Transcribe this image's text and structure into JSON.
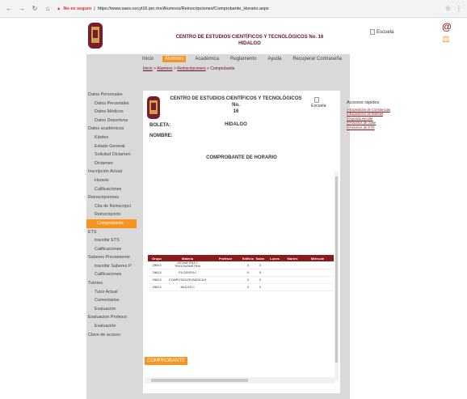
{
  "browser": {
    "insecure_label": "No es seguro",
    "url": "https://www.saes.cecyt16.ipn.mx/Alumnos/Reinscripciones/Comprobante_Horario.aspx"
  },
  "header": {
    "title_line1": "CENTRO DE ESTUDIOS CIENTÍFICOS Y TECNOLÓGICOS No. 16",
    "title_line2": "HIDALGO",
    "escuela_label": "Escuela"
  },
  "top_nav": [
    {
      "label": "Inicio",
      "active": false
    },
    {
      "label": "Alumnos",
      "active": true
    },
    {
      "label": "Académica",
      "active": false
    },
    {
      "label": "Reglamento",
      "active": false
    },
    {
      "label": "Ayuda",
      "active": false
    },
    {
      "label": "Recuperar Contraseña",
      "active": false
    }
  ],
  "breadcrumb": {
    "items": [
      "Inicio",
      "Alumnos",
      "Reinscripciones"
    ],
    "current": "Comprobante",
    "separator": " > "
  },
  "sidebar": [
    {
      "label": "Datos Personales",
      "level": 0
    },
    {
      "label": "Datos Personales",
      "level": 1
    },
    {
      "label": "Datos Médicos",
      "level": 1
    },
    {
      "label": "Datos Deportivos",
      "level": 1
    },
    {
      "label": "Datos académicos",
      "level": 0
    },
    {
      "label": "Kárdex",
      "level": 1
    },
    {
      "label": "Estado General",
      "level": 1
    },
    {
      "label": "Solicitud Dictamen",
      "level": 1
    },
    {
      "label": "Dictamen",
      "level": 1
    },
    {
      "label": "Inscripción Actual",
      "level": 0
    },
    {
      "label": "Horario",
      "level": 1
    },
    {
      "label": "Calificaciones",
      "level": 1
    },
    {
      "label": "Reinscripciones",
      "level": 0
    },
    {
      "label": "Cita de Reinscripci",
      "level": 1
    },
    {
      "label": "Reinscripción",
      "level": 1
    },
    {
      "label": "Comprobante",
      "level": 1,
      "active": true
    },
    {
      "label": "ETS",
      "level": 0
    },
    {
      "label": "Inscribir ETS",
      "level": 1
    },
    {
      "label": "Calificaciones",
      "level": 1
    },
    {
      "label": "Saberes Previamente",
      "level": 0
    },
    {
      "label": "Inscribir Saberes P",
      "level": 1
    },
    {
      "label": "Calificaciones",
      "level": 1
    },
    {
      "label": "Tutores",
      "level": 0
    },
    {
      "label": "Tutor Actual",
      "level": 1
    },
    {
      "label": "Comentarios",
      "level": 1
    },
    {
      "label": "Evaluación",
      "level": 1
    },
    {
      "label": "Evaluacion Profesor",
      "level": 0
    },
    {
      "label": "Evaluación",
      "level": 1
    },
    {
      "label": "Clave de acceso",
      "level": 0
    }
  ],
  "content": {
    "title_line1": "CENTRO DE ESTUDIOS CIENTÍFICOS Y TECNOLÓGICOS No.",
    "title_line2": "16",
    "title_line3": "HIDALGO",
    "escuela_label": "Escuela",
    "boleta_label": "BOLETA:",
    "nombre_label": "NOMBRE:",
    "heading": "COMPROBANTE DE HORARIO",
    "button_label": "COMPROBANTE"
  },
  "table": {
    "headers": [
      "Grupo",
      "Materia",
      "Profesor",
      "Edificio",
      "Salón",
      "Lunes",
      "Martes",
      "Miércole"
    ],
    "rows": [
      [
        "2IM13",
        "GEOMETRIA Y TRIGONOMETRIA",
        "",
        "X",
        "X",
        "",
        "",
        ""
      ],
      [
        "2IM13",
        "FILOSOFIA I",
        "",
        "X",
        "X",
        "",
        "",
        ""
      ],
      [
        "2IM13",
        "COMPUTACION BASICA II",
        "",
        "X",
        "X",
        "",
        "",
        ""
      ],
      [
        "2IM13",
        "INGLES II",
        "",
        "X",
        "X",
        "",
        "",
        ""
      ]
    ]
  },
  "quick_access": {
    "title": "Accesos rápidos",
    "links": [
      "> Expedición de Constancias",
      "> Expedición de Boletas",
      "> Agenda escolar",
      "> Horarios de clase",
      "> Horarios de ETS"
    ]
  },
  "colors": {
    "accent": "#f7941d",
    "guinda": "#6b0f2b",
    "table_header": "#8b1a1a",
    "page_bg": "#d9d9d9"
  }
}
